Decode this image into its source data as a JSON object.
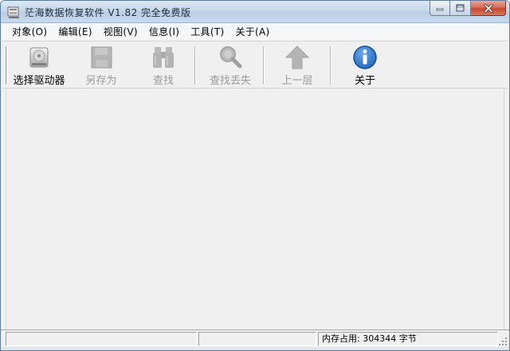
{
  "window": {
    "title": "茫海数据恢复软件 V1.82 完全免费版",
    "controls": {
      "minimize_icon": "minimize-icon",
      "maximize_icon": "maximize-icon",
      "close_icon": "close-icon"
    }
  },
  "menubar": {
    "items": [
      {
        "label": "对象(O)"
      },
      {
        "label": "编辑(E)"
      },
      {
        "label": "视图(V)"
      },
      {
        "label": "信息(I)"
      },
      {
        "label": "工具(T)"
      },
      {
        "label": "关于(A)"
      }
    ]
  },
  "toolbar": {
    "buttons": [
      {
        "label": "选择驱动器",
        "icon": "drive-icon",
        "enabled": true
      },
      {
        "label": "另存为",
        "icon": "save-as-icon",
        "enabled": false
      },
      {
        "label": "查找",
        "icon": "binoculars-icon",
        "enabled": false
      },
      {
        "label": "查找丢失",
        "icon": "magnifier-icon",
        "enabled": false
      },
      {
        "label": "上一层",
        "icon": "up-arrow-icon",
        "enabled": false
      },
      {
        "label": "关于",
        "icon": "info-icon",
        "enabled": true
      }
    ]
  },
  "statusbar": {
    "pane1": "",
    "pane2": "",
    "memory_text": "内存占用: 304344 字节"
  },
  "colors": {
    "titlebar": "#c7d8ea",
    "close_button": "#c7472f",
    "info_icon": "#1d63b8",
    "disabled_gray": "#9a9a9a"
  }
}
